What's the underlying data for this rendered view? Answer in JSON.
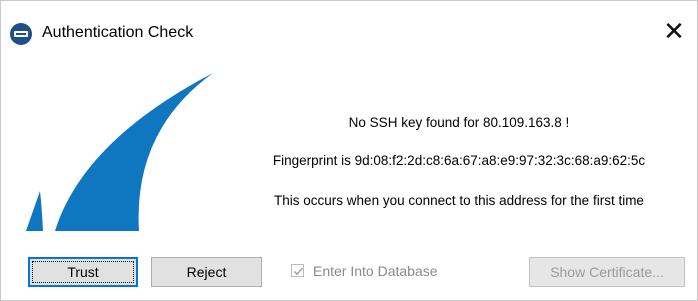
{
  "window": {
    "title": "Authentication Check",
    "close_glyph": "✕"
  },
  "icons": {
    "app": "barracuda-app-icon",
    "logo": "barracuda-fin-logo",
    "close": "close-icon",
    "check": "checkmark-icon"
  },
  "colors": {
    "logo_blue": "#0f76c0",
    "focus_border": "#0078d7",
    "app_icon_bg": "#1e4f8a"
  },
  "message": {
    "line1": "No SSH key found for 80.109.163.8 !",
    "line2": "Fingerprint is 9d:08:f2:2d:c8:6a:67:a8:e9:97:32:3c:68:a9:62:5c",
    "line3": "This occurs when you connect to this address for the first time"
  },
  "buttons": {
    "trust": "Trust",
    "reject": "Reject",
    "show_certificate": "Show Certificate..."
  },
  "checkbox": {
    "label": "Enter Into Database",
    "checked": true,
    "enabled": false
  }
}
